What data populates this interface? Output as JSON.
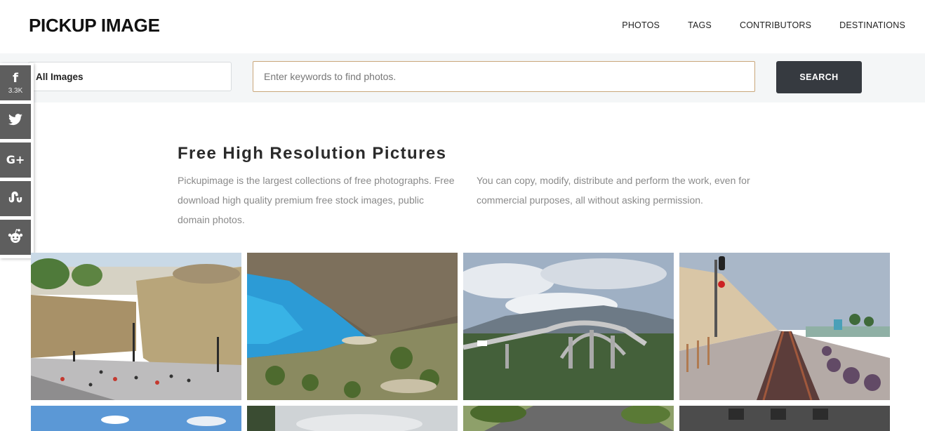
{
  "brand": {
    "logo": "PICKUP IMAGE"
  },
  "nav": [
    "PHOTOS",
    "TAGS",
    "CONTRIBUTORS",
    "DESTINATIONS"
  ],
  "search": {
    "category": "All Images",
    "placeholder": "Enter keywords to find photos.",
    "button_label": "SEARCH"
  },
  "share": {
    "facebook_count": "3.3K",
    "buttons": [
      "facebook",
      "twitter",
      "google-plus",
      "stumbleupon",
      "reddit"
    ]
  },
  "intro": {
    "title": "Free High Resolution Pictures",
    "left_text": "Pickupimage is the largest collections of free photographs. Free download high quality premium free stock images, public domain photos.",
    "right_text": "You can copy, modify, distribute and perform the work, even for commercial purposes, all without asking permission."
  },
  "colors": {
    "search_button": "#363a40",
    "input_border": "#c9a67a",
    "share_buttons": "#5e5e5e"
  }
}
